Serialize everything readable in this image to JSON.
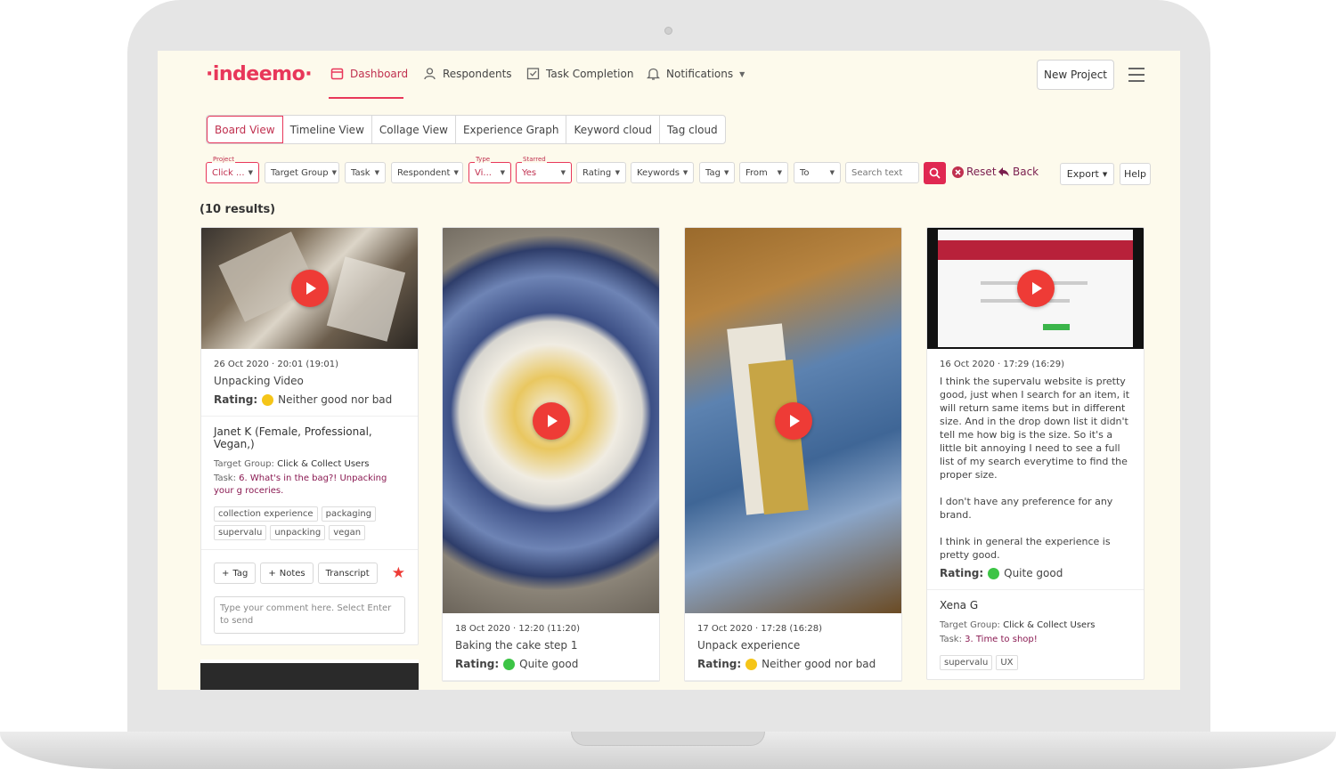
{
  "logo": "·indeemo·",
  "nav": {
    "dashboard": "Dashboard",
    "respondents": "Respondents",
    "task_completion": "Task Completion",
    "notifications": "Notifications"
  },
  "new_project": "New Project",
  "tabs": [
    "Board View",
    "Timeline View",
    "Collage View",
    "Experience Graph",
    "Keyword cloud",
    "Tag cloud"
  ],
  "filters": {
    "project_label": "Project",
    "project": "Click ...",
    "target_group": "Target Group",
    "task": "Task",
    "respondent": "Respondent",
    "type_label": "Type",
    "type": "Vi...",
    "starred_label": "Starred",
    "starred": "Yes",
    "rating": "Rating",
    "keywords": "Keywords",
    "tag": "Tag",
    "from": "From",
    "to": "To",
    "search_placeholder": "Search text",
    "reset": "Reset",
    "back": "Back",
    "export": "Export",
    "help": "Help"
  },
  "results": "(10 results)",
  "cards": [
    {
      "date": "26 Oct 2020 · 20:01 (19:01)",
      "title": "Unpacking Video",
      "rating_label": "Rating:",
      "rating_text": "Neither good nor bad",
      "person": "Janet K (Female, Professional, Vegan,)",
      "tg_label": "Target Group:",
      "tg_value": "Click & Collect Users",
      "task_label": "Task:",
      "task_value": "6. What's in the bag?! Unpacking your g roceries.",
      "tags": [
        "collection experience",
        "packaging",
        "supervalu",
        "unpacking",
        "vegan"
      ],
      "tag_btn": "Tag",
      "notes_btn": "Notes",
      "transcript_btn": "Transcript",
      "comment_placeholder": "Type your comment here. Select Enter to send"
    },
    {
      "date": "18 Oct 2020 · 12:20 (11:20)",
      "title": "Baking the cake step 1",
      "rating_label": "Rating:",
      "rating_text": "Quite good"
    },
    {
      "date": "17 Oct 2020 · 17:28 (16:28)",
      "title": "Unpack experience",
      "rating_label": "Rating:",
      "rating_text": "Neither good nor bad"
    },
    {
      "date": "16 Oct 2020 · 17:29 (16:29)",
      "description": "I think the supervalu website is pretty good, just when I search for an item, it will return same items but in different size. And in the drop down list it didn't tell me how big is the size. So it's a little bit annoying I need to see a full list of my search everytime to find the proper size.\n\nI don't have any preference for any brand.\n\nI think in general the experience is pretty good.",
      "rating_label": "Rating:",
      "rating_text": "Quite good",
      "person": "Xena G",
      "tg_label": "Target Group:",
      "tg_value": "Click & Collect Users",
      "task_label": "Task:",
      "task_value": "3. Time to shop!",
      "tags": [
        "supervalu",
        "UX"
      ]
    }
  ]
}
